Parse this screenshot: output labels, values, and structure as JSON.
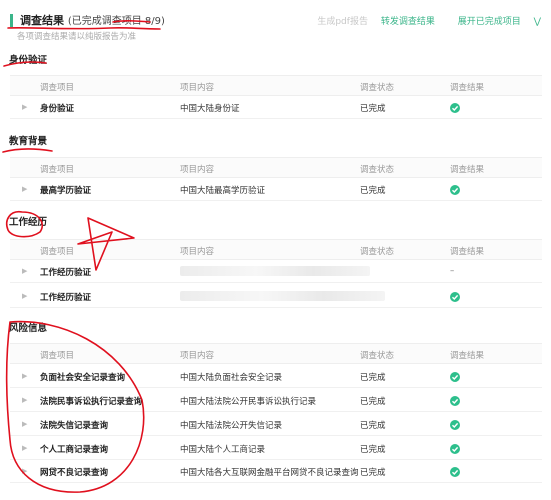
{
  "header": {
    "title": "调查结果",
    "subtitle": "(已完成调查项目 8/9)",
    "hint": "各项调查结果请以纯版报告为准",
    "actions": {
      "generate_pdf": "生成pdf报告",
      "forward": "转发调查结果",
      "expand": "展开已完成项目"
    }
  },
  "columns": {
    "item": "调查项目",
    "content": "项目内容",
    "status": "调查状态",
    "result": "调查结果"
  },
  "sections": {
    "identity": {
      "title": "身份验证",
      "rows": [
        {
          "item": "身份验证",
          "content": "中国大陆身份证",
          "status": "已完成",
          "result": "check"
        }
      ]
    },
    "education": {
      "title": "教育背景",
      "rows": [
        {
          "item": "最高学历验证",
          "content": "中国大陆最高学历验证",
          "status": "已完成",
          "result": "check"
        }
      ]
    },
    "work": {
      "title": "工作经历",
      "rows": [
        {
          "item": "工作经历验证",
          "content": "",
          "status": "",
          "result": "–"
        },
        {
          "item": "工作经历验证",
          "content": "",
          "status": "",
          "result": "check"
        }
      ]
    },
    "risk": {
      "title": "风险信息",
      "rows": [
        {
          "item": "负面社会安全记录查询",
          "content": "中国大陆负面社会安全记录",
          "status": "已完成",
          "result": "check"
        },
        {
          "item": "法院民事诉讼执行记录查询",
          "content": "中国大陆法院公开民事诉讼执行记录",
          "status": "已完成",
          "result": "check"
        },
        {
          "item": "法院失信记录查询",
          "content": "中国大陆法院公开失信记录",
          "status": "已完成",
          "result": "check"
        },
        {
          "item": "个人工商记录查询",
          "content": "中国大陆个人工商记录",
          "status": "已完成",
          "result": "check"
        },
        {
          "item": "网贷不良记录查询",
          "content": "中国大陆各大互联网金融平台网贷不良记录查询",
          "status": "已完成",
          "result": "check"
        }
      ]
    }
  },
  "colors": {
    "accent": "#3bb58a",
    "check": "#2dbf8c",
    "annotation": "#e0101e"
  },
  "icons": {
    "row_arrow": "caret-right-icon",
    "result_ok": "check-circle-icon",
    "expand": "double-chevron-down-icon"
  }
}
